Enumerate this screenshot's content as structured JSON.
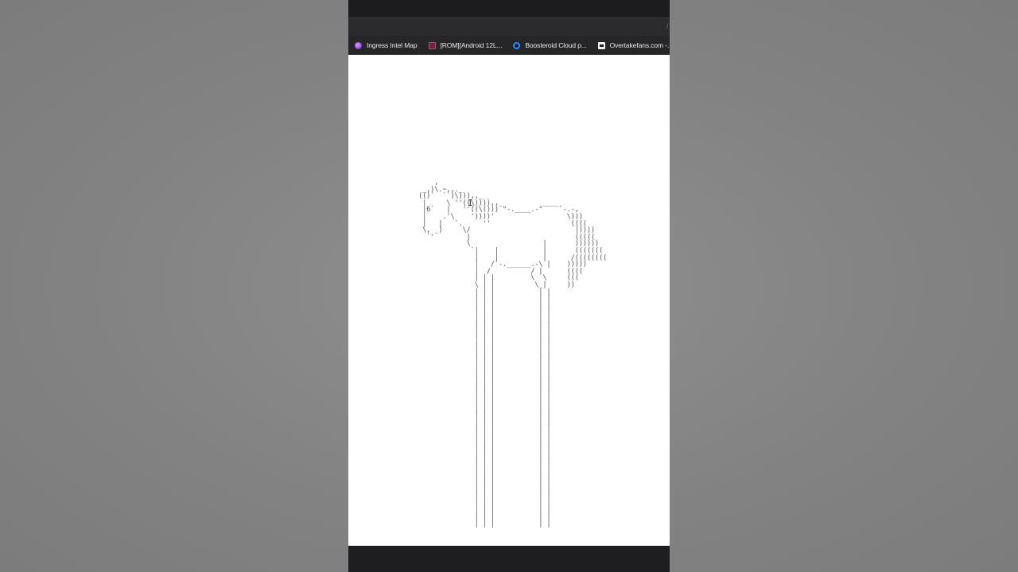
{
  "colors": {
    "backdrop": "#858585",
    "chrome_dark": "#1c1c1e",
    "toolbar": "#2b2b2d",
    "bookmarks_bar": "#262628",
    "page_background": "#ffffff",
    "ascii_color": "#4a4a52"
  },
  "bookmarks": [
    {
      "label": "Ingress Intel Map",
      "icon": "ingress-icon"
    },
    {
      "label": "[ROM][Android 12L...",
      "icon": "rom-icon"
    },
    {
      "label": "Boosteroid Cloud p...",
      "icon": "boosteroid-icon"
    },
    {
      "label": "Overtakefans.com -...",
      "icon": "overtakefans-icon"
    },
    {
      "label": "",
      "icon": "globe-icon"
    }
  ],
  "page": {
    "ascii_art": "        ,\n     _,)\\.~,,._\n    (()`  ``)\\))),,_\n     |     \\ ''((\\)))),,_          ____\n     |6`   |   ''((\\())) \"-.____.-\"    `-.-,\n     |    .'\\    '))))'                  \\)))\n     |   |   `.     ''                    ((((\n     \\, _)     \\/                          |))))\n      `'        |                          (((((\n                \\                  |       ))))))\n                 `|    |           |       (((((((\n                  |    |           |      /((((((((\n                  |   /`-.______.-\\ |    )))))\n                  |  /          / |      ((((\n                  | | |         \\  \\     (((\n                  \\ | |          \\_|     ))\n                  | | |           | |\n                  | | |           | |\n                  | | |           | |\n                  | | |           | |\n                  | | |           | |\n                  | | |           | |\n                  | | |           | |\n                  | | |           | |\n                  | | |           | |\n                  | | |           | |\n                  | | |           | |\n                  | | |           | |\n                  | | |           | |\n                  | | |           | |\n                  | | |           | |\n                  | | |           | |\n                  | | |           | |\n                  | | |           | |\n                  | | |           | |\n                  | | |           | |\n                  | | |           | |\n                  | | |           | |\n                  | | |           | |\n                  | | |           | |\n                  | | |           | |\n                  | | |           | |\n                  | | |           | |\n                  | | |           | |\n                  | | |           | |\n                  | | |           | |\n                  | | |           | |\n                  | | |           | |\n                  | | |           | |\n                  | | |           | |\n                  | | |           | |",
    "cursor": "I"
  }
}
